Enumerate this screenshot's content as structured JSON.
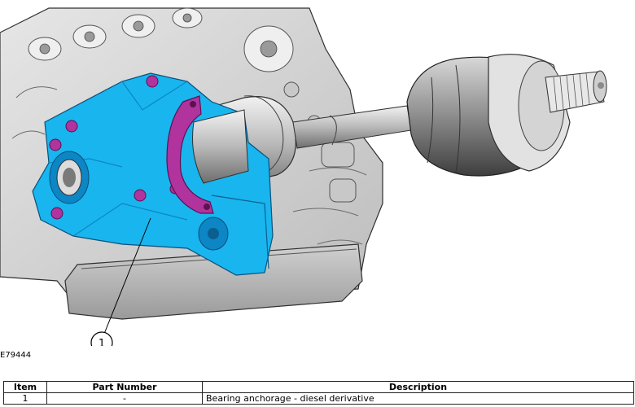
{
  "figure": {
    "callout_number": "1",
    "figure_id": "E79444"
  },
  "table": {
    "headers": {
      "item": "Item",
      "part_number": "Part Number",
      "description": "Description"
    },
    "rows": [
      {
        "item": "1",
        "part_number": "-",
        "description": "Bearing anchorage - diesel derivative"
      }
    ]
  },
  "colors": {
    "bracket": "#19b5ee",
    "bracket_dark": "#0c86c4",
    "clamp": "#b0339e",
    "engine": "#d6d6d6",
    "outline": "#303030"
  }
}
